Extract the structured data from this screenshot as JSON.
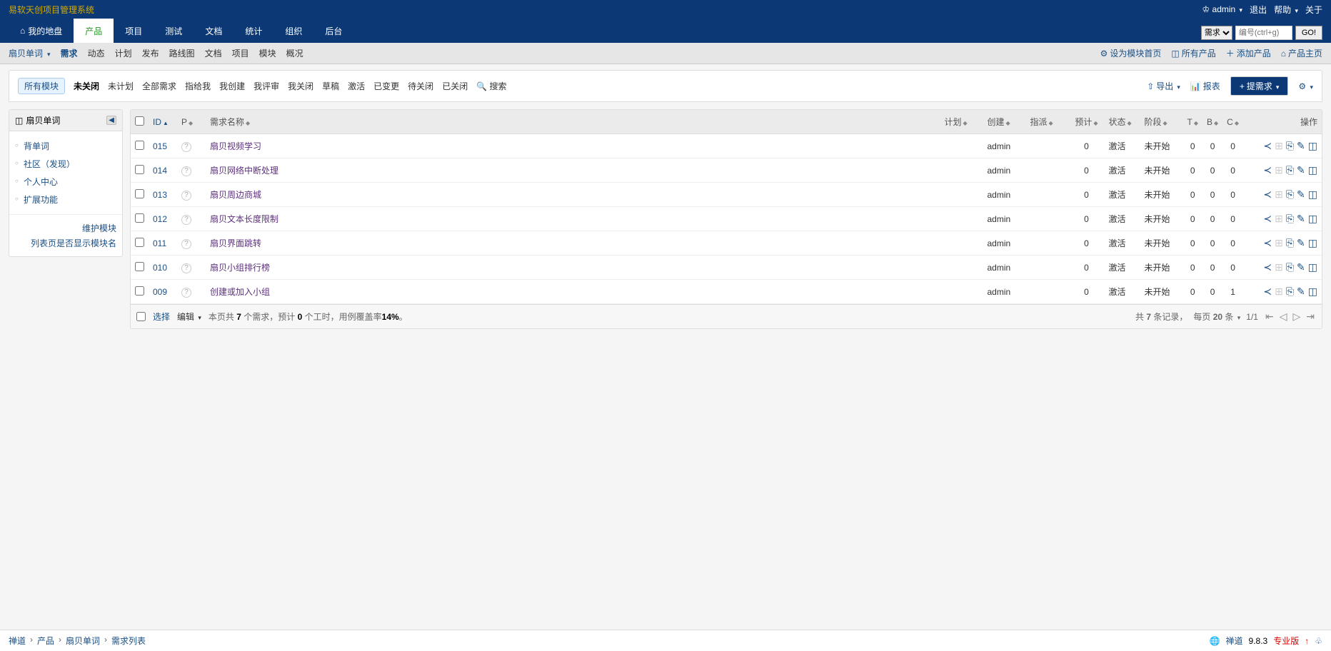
{
  "header": {
    "title": "易软天创项目管理系统",
    "user": "admin",
    "logout": "退出",
    "help": "帮助",
    "about": "关于",
    "search_select": "需求",
    "search_placeholder": "编号(ctrl+g)",
    "go": "GO!"
  },
  "main_nav": [
    {
      "label": "我的地盘",
      "icon": "home"
    },
    {
      "label": "产品",
      "active": true
    },
    {
      "label": "项目"
    },
    {
      "label": "测试"
    },
    {
      "label": "文档"
    },
    {
      "label": "统计"
    },
    {
      "label": "组织"
    },
    {
      "label": "后台"
    }
  ],
  "sub_nav": {
    "product": "扇贝单词",
    "tabs": [
      "需求",
      "动态",
      "计划",
      "发布",
      "路线图",
      "文档",
      "项目",
      "模块",
      "概况"
    ],
    "active_tab": "需求",
    "right": [
      {
        "label": "设为模块首页",
        "icon": "gear"
      },
      {
        "label": "所有产品",
        "icon": "grid"
      },
      {
        "label": "添加产品",
        "icon": "plus"
      },
      {
        "label": "产品主页",
        "icon": "home"
      }
    ]
  },
  "filter": {
    "module_tag": "所有模块",
    "filters": [
      "未关闭",
      "未计划",
      "全部需求",
      "指给我",
      "我创建",
      "我评审",
      "我关闭",
      "草稿",
      "激活",
      "已变更",
      "待关闭",
      "已关闭"
    ],
    "active_filter": "未关闭",
    "search": "搜索",
    "export": "导出",
    "report": "报表",
    "create": "提需求"
  },
  "sidebar": {
    "title": "扇贝单词",
    "items": [
      "背单词",
      "社区（发现）",
      "个人中心",
      "扩展功能"
    ],
    "footer": [
      "维护模块",
      "列表页是否显示模块名"
    ]
  },
  "table": {
    "headers": {
      "id": "ID",
      "p": "P",
      "name": "需求名称",
      "plan": "计划",
      "creator": "创建",
      "assign": "指派",
      "estimate": "预计",
      "status": "状态",
      "stage": "阶段",
      "t": "T",
      "b": "B",
      "c": "C",
      "actions": "操作"
    },
    "rows": [
      {
        "id": "015",
        "name": "扇贝视频学习",
        "creator": "admin",
        "estimate": "0",
        "status": "激活",
        "stage": "未开始",
        "t": "0",
        "b": "0",
        "c": "0"
      },
      {
        "id": "014",
        "name": "扇贝网络中断处理",
        "creator": "admin",
        "estimate": "0",
        "status": "激活",
        "stage": "未开始",
        "t": "0",
        "b": "0",
        "c": "0"
      },
      {
        "id": "013",
        "name": "扇贝周边商城",
        "creator": "admin",
        "estimate": "0",
        "status": "激活",
        "stage": "未开始",
        "t": "0",
        "b": "0",
        "c": "0"
      },
      {
        "id": "012",
        "name": "扇贝文本长度限制",
        "creator": "admin",
        "estimate": "0",
        "status": "激活",
        "stage": "未开始",
        "t": "0",
        "b": "0",
        "c": "0"
      },
      {
        "id": "011",
        "name": "扇贝界面跳转",
        "creator": "admin",
        "estimate": "0",
        "status": "激活",
        "stage": "未开始",
        "t": "0",
        "b": "0",
        "c": "0"
      },
      {
        "id": "010",
        "name": "扇贝小组排行榜",
        "creator": "admin",
        "estimate": "0",
        "status": "激活",
        "stage": "未开始",
        "t": "0",
        "b": "0",
        "c": "0"
      },
      {
        "id": "009",
        "name": "创建或加入小组",
        "creator": "admin",
        "estimate": "0",
        "status": "激活",
        "stage": "未开始",
        "t": "0",
        "b": "0",
        "c": "1"
      }
    ],
    "footer": {
      "select": "选择",
      "edit": "编辑",
      "summary_prefix": "本页共 ",
      "summary_count": "7",
      "summary_mid": " 个需求，预计 ",
      "summary_hours": "0",
      "summary_mid2": " 个工时，用例覆盖率",
      "summary_coverage": "14%",
      "summary_suffix": "。",
      "total_prefix": "共 ",
      "total": "7",
      "total_suffix": " 条记录，",
      "per_page_prefix": "每页 ",
      "per_page": "20",
      "per_page_suffix": " 条",
      "page": "1/1"
    }
  },
  "breadcrumb": {
    "items": [
      "禅道",
      "产品",
      "扇贝单词",
      "需求列表"
    ],
    "app": "禅道",
    "version": "9.8.3",
    "edition": "专业版"
  }
}
